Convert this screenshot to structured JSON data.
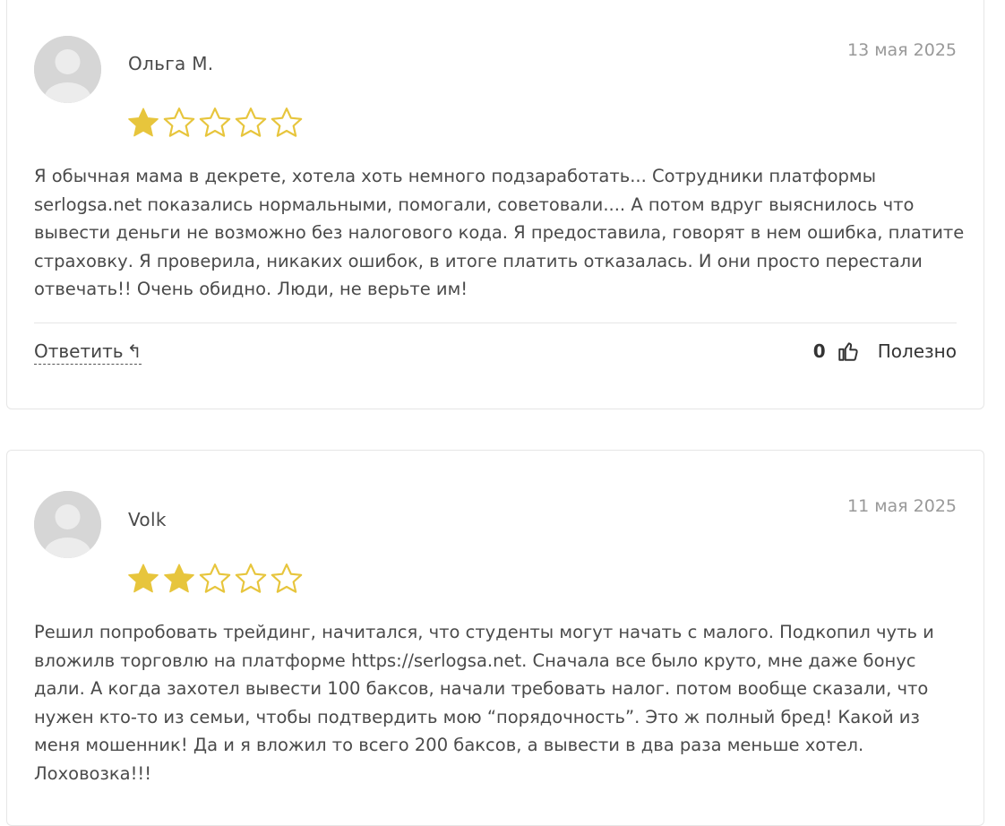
{
  "colors": {
    "star_filled": "#e7c53c",
    "star_empty_stroke": "#e7c53c",
    "card_border": "#e6e6e6",
    "avatar_bg": "#d9d9d9",
    "date_color": "#999999"
  },
  "reviews": [
    {
      "author": "Ольга М.",
      "date": "13 мая 2025",
      "rating": 1,
      "max_rating": 5,
      "text": "Я обычная мама в декрете, хотела хоть немного подзаработать... Сотрудники платформы serlogsa.net показались нормальными, помогали, советовали.... А потом вдруг выяснилось что вывести деньги не возможно без налогового кода. Я предоставила, говорят в нем ошибка, платите страховку. Я проверила, никаких ошибок, в итоге платить отказалась. И они просто перестали отвечать!! Очень обидно. Люди, не верьте им!",
      "reply_label": "Ответить",
      "reply_icon": "reply-arrow-icon",
      "helpful_count": "0",
      "helpful_label": "Полезно",
      "helpful_icon": "thumbs-up-icon"
    },
    {
      "author": "Volk",
      "date": "11 мая 2025",
      "rating": 2,
      "max_rating": 5,
      "text": "Решил попробовать трейдинг, начитался, что студенты могут начать с малого. Подкопил чуть и вложилв торговлю на платформе https://serlogsa.net. Сначала все было круто, мне даже бонус дали. А когда захотел вывести 100 баксов, начали требовать налог. потом вообще сказали, что нужен кто-то из семьи, чтобы подтвердить мою “порядочность”. Это ж полный бред! Какой из меня мошенник! Да и я вложил то всего 200 баксов, а вывести в два раза меньше хотел. Лоховозка!!!"
    }
  ]
}
